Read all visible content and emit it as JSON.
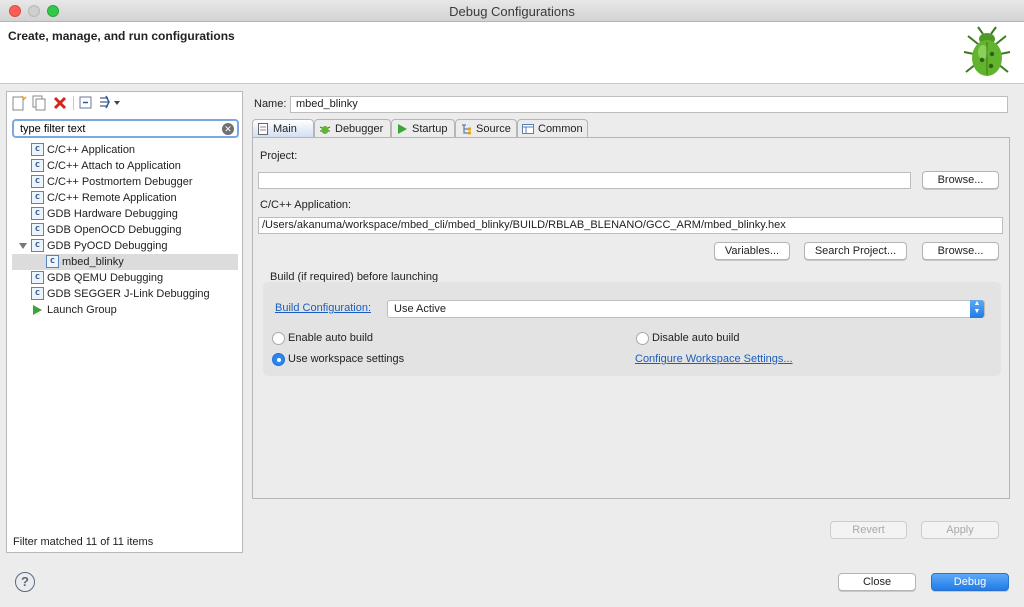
{
  "window": {
    "title": "Debug Configurations"
  },
  "header": {
    "title": "Create, manage, and run configurations",
    "icon": "bug-icon"
  },
  "left": {
    "filter_placeholder": "type filter text",
    "filter_value": "type filter text",
    "tree": [
      {
        "label": "C/C++ Application",
        "icon": "c-config-icon"
      },
      {
        "label": "C/C++ Attach to Application",
        "icon": "c-config-icon"
      },
      {
        "label": "C/C++ Postmortem Debugger",
        "icon": "c-config-icon"
      },
      {
        "label": "C/C++ Remote Application",
        "icon": "c-config-icon"
      },
      {
        "label": "GDB Hardware Debugging",
        "icon": "c-config-icon"
      },
      {
        "label": "GDB OpenOCD Debugging",
        "icon": "c-config-icon"
      },
      {
        "label": "GDB PyOCD Debugging",
        "icon": "c-config-icon"
      },
      {
        "label": "mbed_blinky",
        "icon": "c-config-icon"
      },
      {
        "label": "GDB QEMU Debugging",
        "icon": "c-config-icon"
      },
      {
        "label": "GDB SEGGER J-Link Debugging",
        "icon": "c-config-icon"
      },
      {
        "label": "Launch Group",
        "icon": "launch-icon"
      }
    ],
    "status": "Filter matched 11 of 11 items"
  },
  "config": {
    "name_label": "Name:",
    "name_value": "mbed_blinky",
    "tabs": [
      {
        "label": "Main"
      },
      {
        "label": "Debugger"
      },
      {
        "label": "Startup"
      },
      {
        "label": "Source"
      },
      {
        "label": "Common"
      }
    ],
    "project_label": "Project:",
    "project_value": "",
    "browse_label": "Browse...",
    "app_label": "C/C++ Application:",
    "app_value": "/Users/akanuma/workspace/mbed_cli/mbed_blinky/BUILD/RBLAB_BLENANO/GCC_ARM/mbed_blinky.hex",
    "variables_label": "Variables...",
    "search_project_label": "Search Project...",
    "browse2_label": "Browse...",
    "build_group_label": "Build (if required) before launching",
    "build_config_link": "Build Configuration:",
    "build_config_value": "Use Active",
    "enable_auto_build": "Enable auto build",
    "disable_auto_build": "Disable auto build",
    "use_workspace_settings": "Use workspace settings",
    "configure_workspace_link": "Configure Workspace Settings...",
    "revert_label": "Revert",
    "apply_label": "Apply"
  },
  "footer": {
    "help": "?",
    "close_label": "Close",
    "debug_label": "Debug"
  }
}
